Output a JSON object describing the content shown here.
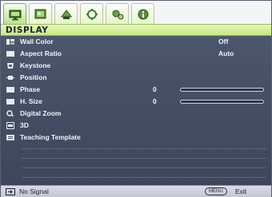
{
  "tabs": [
    {
      "icon": "display-monitor-icon",
      "active": true
    },
    {
      "icon": "picture-icon",
      "active": false
    },
    {
      "icon": "setup-basic-icon",
      "active": false
    },
    {
      "icon": "setup-advanced-icon",
      "active": false
    },
    {
      "icon": "system-settings-icon",
      "active": false
    },
    {
      "icon": "information-icon",
      "active": false
    }
  ],
  "header": {
    "title": "DISPLAY"
  },
  "menu": [
    {
      "label": "Wall Color",
      "value": "Off",
      "icon": "wall-color-icon"
    },
    {
      "label": "Aspect Ratio",
      "value": "Auto",
      "icon": "aspect-ratio-icon"
    },
    {
      "label": "Keystone",
      "icon": "keystone-icon"
    },
    {
      "label": "Position",
      "icon": "position-icon"
    },
    {
      "label": "Phase",
      "value": "0",
      "level": 0.0,
      "icon": "phase-icon"
    },
    {
      "label": "H. Size",
      "value": "0",
      "level": 0.0,
      "icon": "h-size-icon"
    },
    {
      "label": "Digital Zoom",
      "icon": "digital-zoom-icon"
    },
    {
      "label": "3D",
      "icon": "3d-icon"
    },
    {
      "label": "Teaching Template",
      "icon": "teaching-template-icon"
    }
  ],
  "footer": {
    "source_icon": "input-source-icon",
    "status": "No Signal",
    "menu_key": "MENU",
    "exit_label": "Exit"
  },
  "colors": {
    "accent_green": "#c7ea7e",
    "panel": "#464f63",
    "footer": "#cfd2da"
  }
}
